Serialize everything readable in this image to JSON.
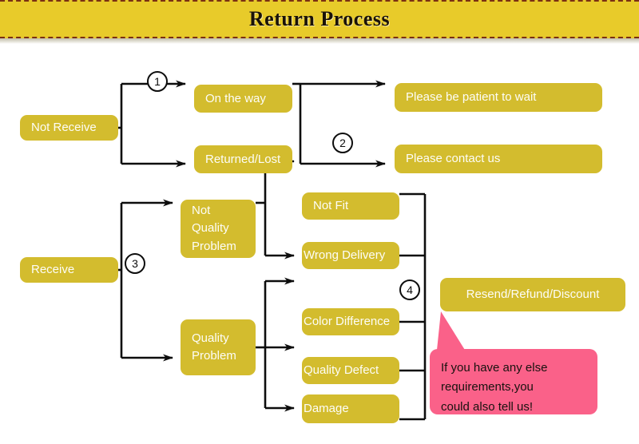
{
  "header": {
    "title": "Return Process"
  },
  "colors": {
    "banner": "#e8cb2a",
    "node": "#d3bc2e",
    "callout": "#fa6189",
    "line": "#0d0d0d",
    "node_text": "#fdfdf7",
    "banner_text": "#1a1208",
    "dash": "#7a2f12"
  },
  "flow": {
    "roots": [
      {
        "id": "not-receive",
        "label": "Not Receive"
      },
      {
        "id": "receive",
        "label": "Receive"
      }
    ],
    "stage2": [
      {
        "id": "on-the-way",
        "label": "On the way"
      },
      {
        "id": "returned-lost",
        "label": "Returned/Lost"
      },
      {
        "id": "not-quality-problem",
        "label": "Not\nQuality\nProblem"
      },
      {
        "id": "quality-problem",
        "label": "Quality\nProblem"
      }
    ],
    "stage3": [
      {
        "id": "be-patient",
        "label": "Please be patient to wait"
      },
      {
        "id": "contact-us",
        "label": "Please contact us"
      },
      {
        "id": "not-fit",
        "label": "Not Fit"
      },
      {
        "id": "wrong-delivery",
        "label": "Wrong Delivery"
      },
      {
        "id": "color-difference",
        "label": "Color Difference"
      },
      {
        "id": "quality-defect",
        "label": "Quality Defect"
      },
      {
        "id": "damage",
        "label": "Damage"
      }
    ],
    "outcome": {
      "id": "resend-refund-discount",
      "label": "Resend/Refund/Discount"
    },
    "markers": [
      {
        "id": "step-1",
        "label": "1"
      },
      {
        "id": "step-2",
        "label": "2"
      },
      {
        "id": "step-3",
        "label": "3"
      },
      {
        "id": "step-4",
        "label": "4"
      }
    ]
  },
  "callout": {
    "line1": "If you have any else",
    "line2": "requirements,you",
    "line3": "could also tell us!"
  }
}
